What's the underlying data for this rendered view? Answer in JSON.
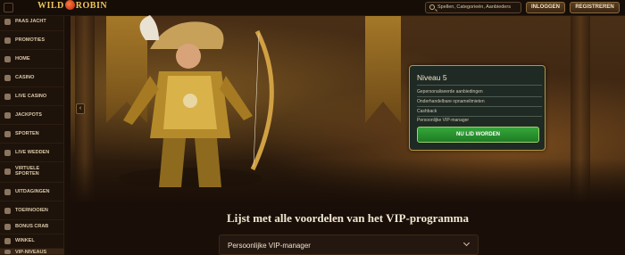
{
  "header": {
    "logo_text_left": "WILD",
    "logo_text_right": "ROBIN",
    "search_placeholder": "Spellen, Categorieën, Aanbieders",
    "login_label": "INLOGGEN",
    "register_label": "REGISTREREN"
  },
  "sidebar": {
    "items": [
      {
        "label": "PAAS JACHT",
        "icon": "egg-icon"
      },
      {
        "label": "PROMOTIES",
        "icon": "gift-icon"
      },
      {
        "label": "HOME",
        "icon": "home-icon"
      },
      {
        "label": "CASINO",
        "icon": "cards-icon"
      },
      {
        "label": "LIVE CASINO",
        "icon": "live-icon"
      },
      {
        "label": "JACKPOTS",
        "icon": "jackpot-icon"
      },
      {
        "label": "SPORTEN",
        "icon": "ball-icon"
      },
      {
        "label": "LIVE WEDDEN",
        "icon": "live-bet-icon"
      },
      {
        "label": "VIRTUELE SPORTEN",
        "icon": "virtual-icon"
      },
      {
        "label": "UITDAGINGEN",
        "icon": "challenge-icon"
      },
      {
        "label": "TOERNOOIEN",
        "icon": "trophy-icon"
      },
      {
        "label": "BONUS CRAB",
        "icon": "crab-icon"
      },
      {
        "label": "WINKEL",
        "icon": "shop-icon"
      },
      {
        "label": "VIP-NIVEAUS",
        "icon": "crown-icon"
      }
    ]
  },
  "hero": {
    "prev_arrow": "‹"
  },
  "vip_card": {
    "title": "Niveau 5",
    "perks": [
      "Gepersonaliseerde aanbiedingen",
      "Onderhandelbare opnamelimieten",
      "Cashback",
      "Persoonlijke VIP-manager"
    ],
    "cta_label": "NU LID WORDEN"
  },
  "section": {
    "title": "Lijst met alle voordelen van het VIP-programma",
    "accordion_label": "Persoonlijke VIP-manager"
  }
}
